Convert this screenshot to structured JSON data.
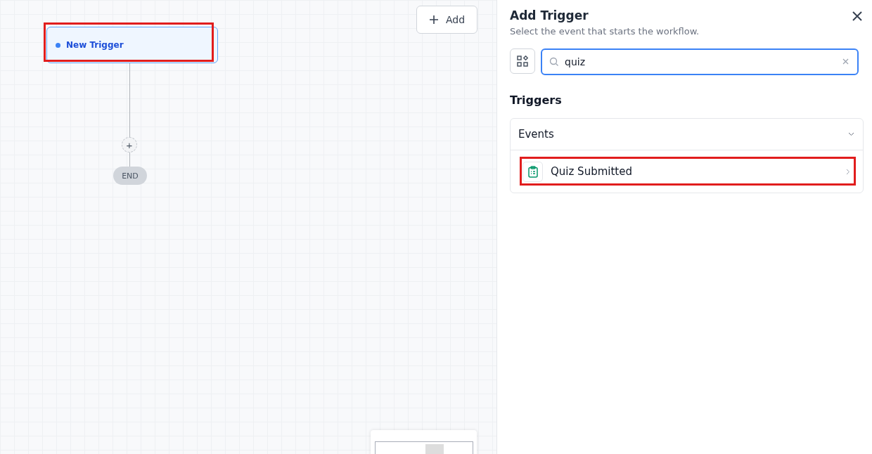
{
  "canvas": {
    "add_button": "Add",
    "trigger_node": {
      "label": "New Trigger",
      "highlighted": true
    },
    "add_step": "+",
    "end_node": "END"
  },
  "panel": {
    "title": "Add Trigger",
    "subtitle": "Select the event that starts the workflow.",
    "search": {
      "value": "quiz"
    },
    "section_title": "Triggers",
    "groups": [
      {
        "title": "Events",
        "expanded": true,
        "items": [
          {
            "label": "Quiz Submitted",
            "highlighted": true
          }
        ]
      }
    ]
  }
}
